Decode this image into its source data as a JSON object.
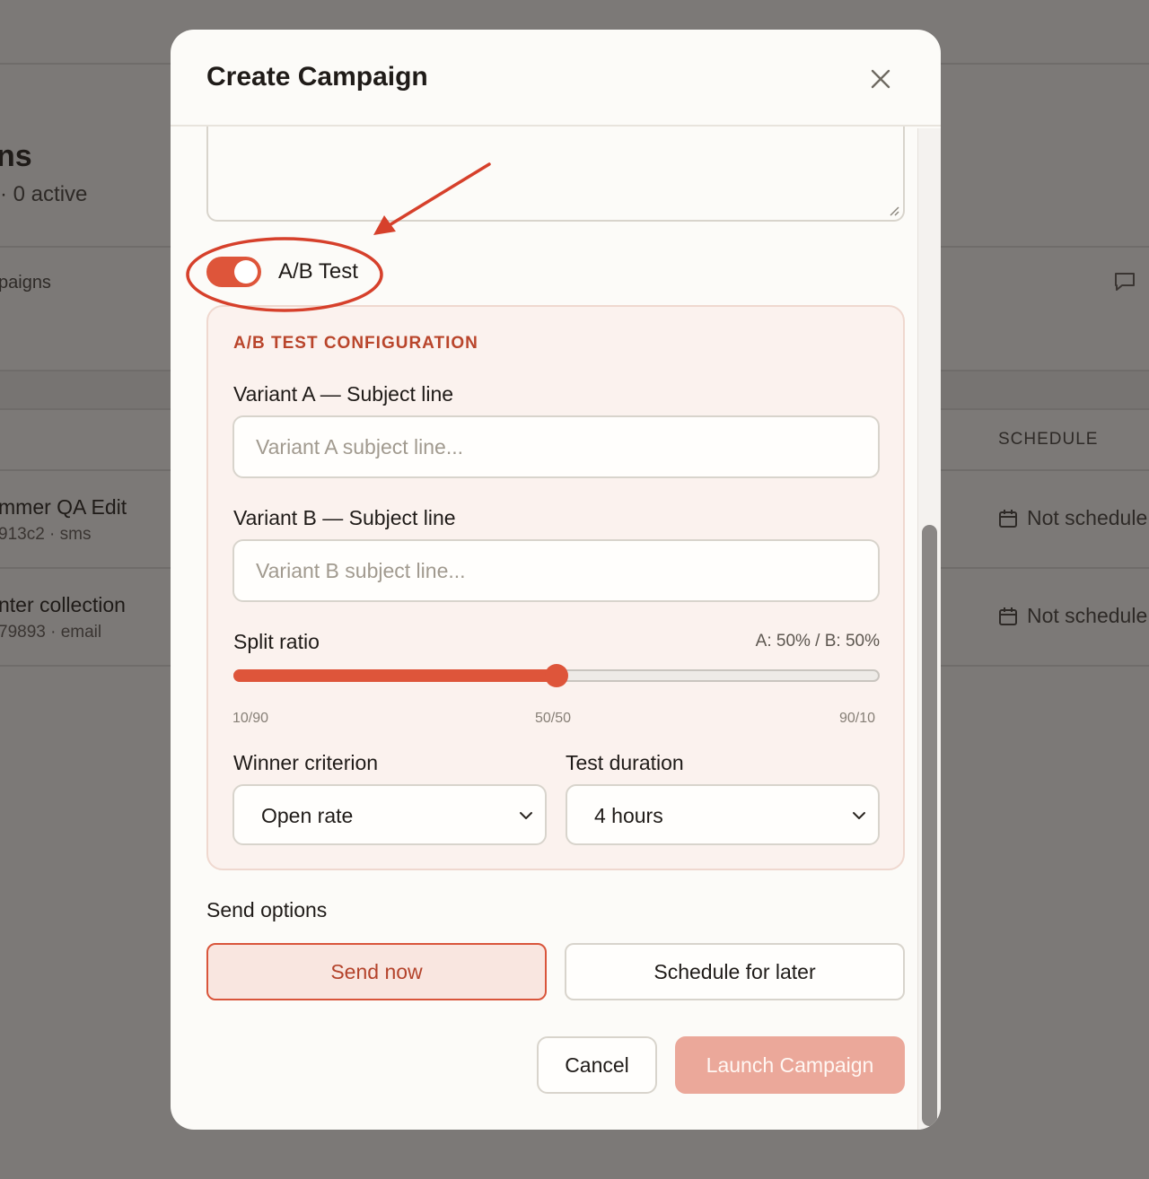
{
  "background": {
    "page_title_fragment": "ns",
    "page_subtitle_fragment": "· 0 active",
    "tab_fragment": "paigns",
    "column_header": "SCHEDULE",
    "rows": [
      {
        "title": "mmer QA Edit",
        "sub": "913c2 · sms",
        "schedule": "Not schedule"
      },
      {
        "title": "nter collection",
        "sub": "79893 · email",
        "schedule": "Not schedule"
      }
    ]
  },
  "modal": {
    "title": "Create Campaign",
    "ab_toggle": {
      "label": "A/B Test",
      "on": true
    },
    "config": {
      "heading": "A/B TEST CONFIGURATION",
      "variant_a_label": "Variant A — Subject line",
      "variant_a_placeholder": "Variant A subject line...",
      "variant_b_label": "Variant B — Subject line",
      "variant_b_placeholder": "Variant B subject line...",
      "split_label": "Split ratio",
      "split_value_text": "A: 50% / B: 50%",
      "split_percent": 50,
      "split_ticks": [
        "10/90",
        "50/50",
        "90/10"
      ],
      "winner_label": "Winner criterion",
      "winner_value": "Open rate",
      "duration_label": "Test duration",
      "duration_value": "4 hours"
    },
    "send_options": {
      "label": "Send options",
      "send_now": "Send now",
      "schedule_later": "Schedule for later",
      "selected": "Send now"
    },
    "cancel": "Cancel",
    "launch": "Launch Campaign"
  },
  "colors": {
    "accent": "#de553a",
    "annotation": "#d6402b",
    "launch_disabled": "#eba89a",
    "config_bg": "#fbf2ee"
  },
  "icons": [
    "close-icon",
    "chevron-down-icon",
    "calendar-icon",
    "chat-icon",
    "resize-grip-icon"
  ]
}
